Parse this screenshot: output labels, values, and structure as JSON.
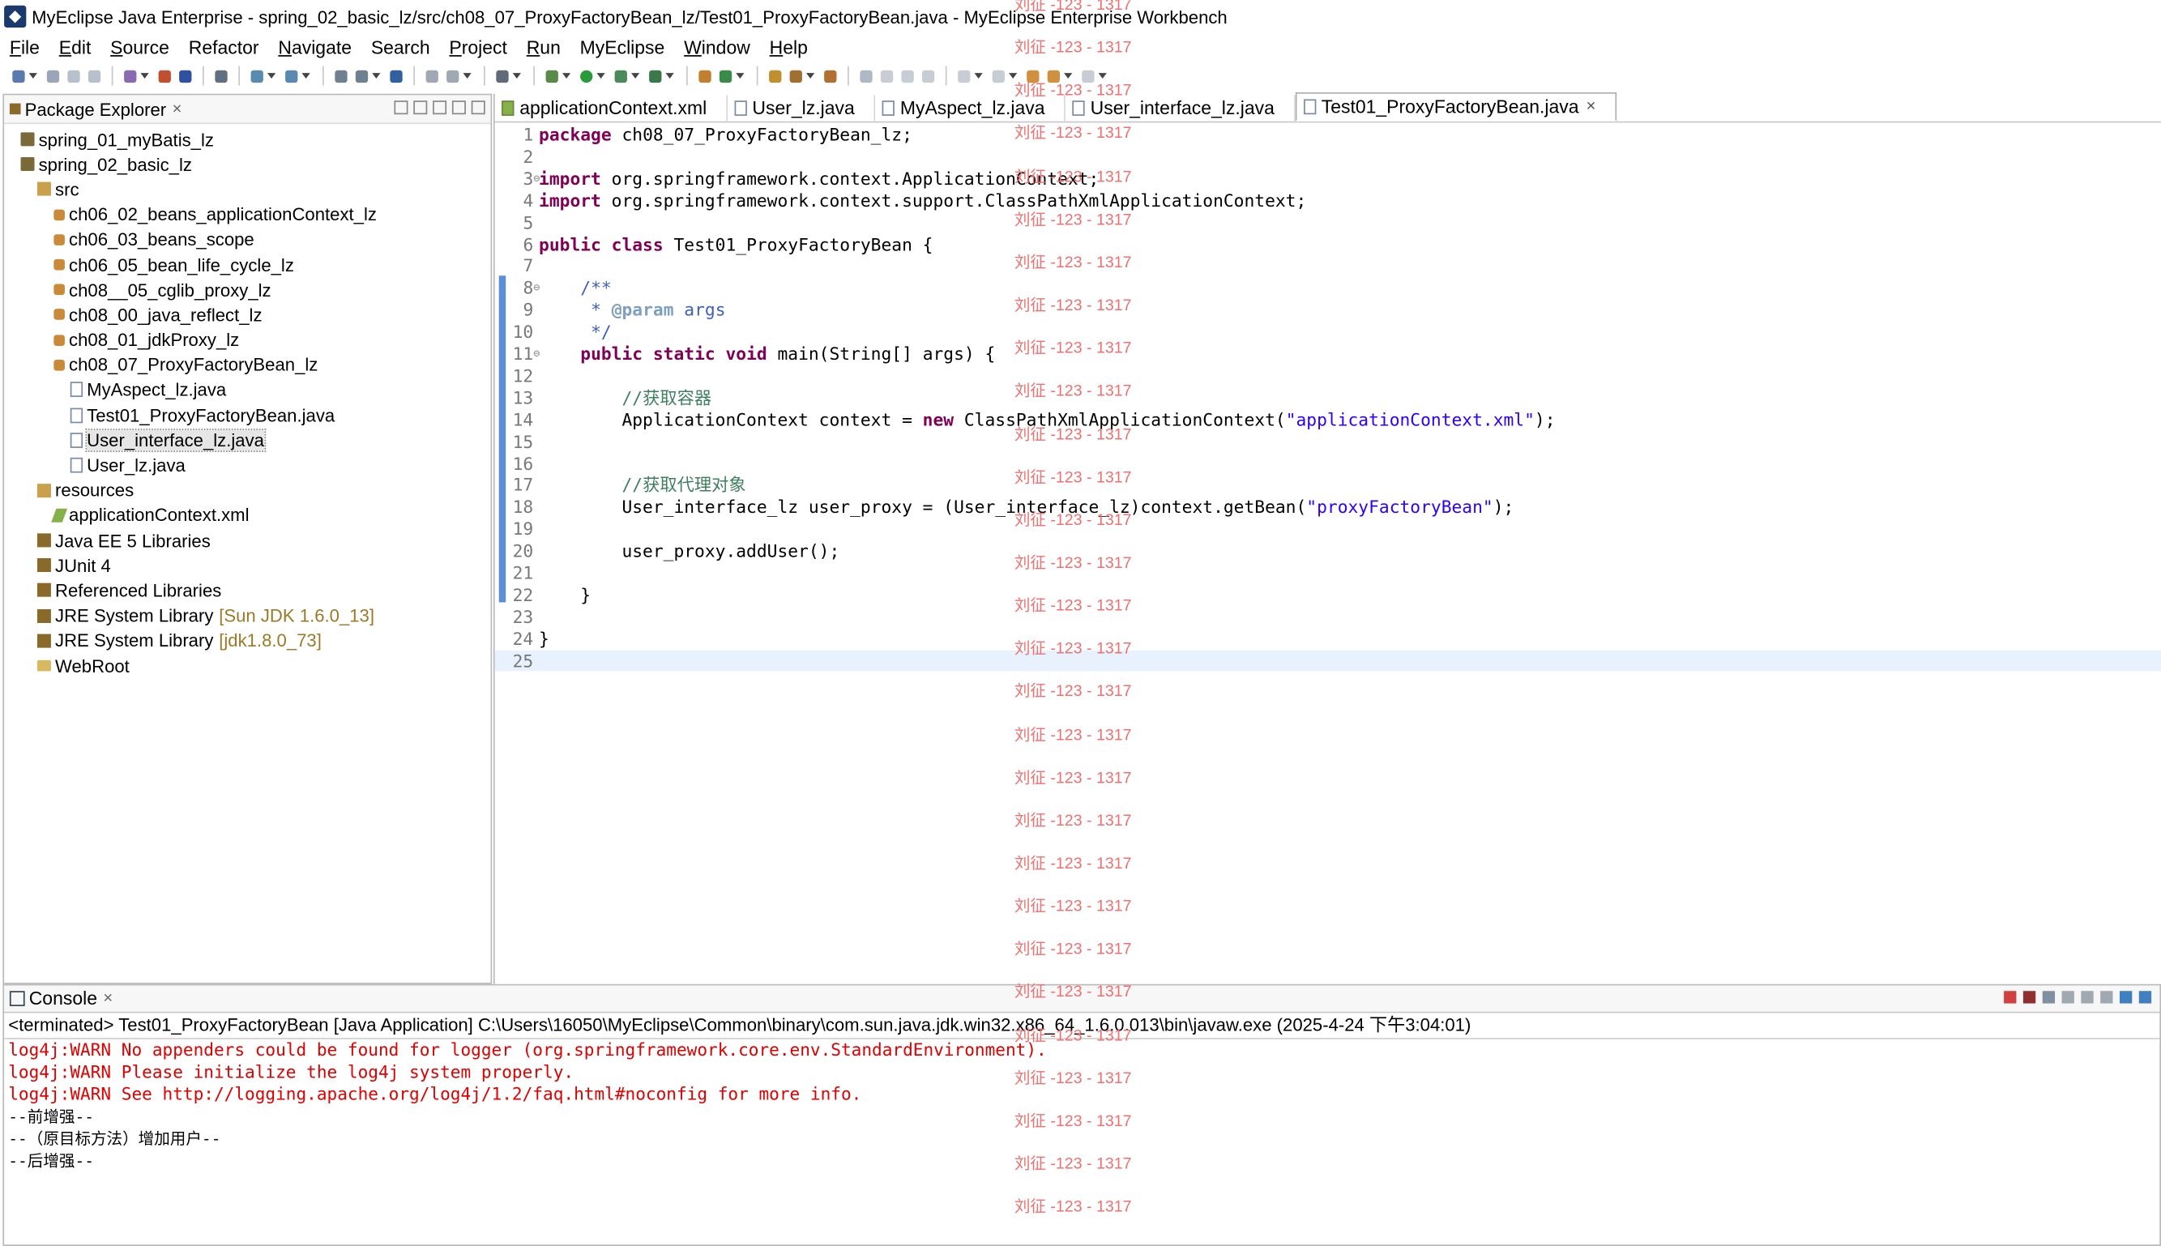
{
  "window": {
    "title": "MyEclipse Java Enterprise - spring_02_basic_lz/src/ch08_07_ProxyFactoryBean_lz/Test01_ProxyFactoryBean.java - MyEclipse Enterprise Workbench"
  },
  "menu": [
    {
      "label": "File",
      "mnemonic": "F",
      "rest": "ile"
    },
    {
      "label": "Edit",
      "mnemonic": "E",
      "rest": "dit"
    },
    {
      "label": "Source",
      "mnemonic": "S",
      "rest": "ource"
    },
    {
      "label": "Refactor",
      "mnemonic": "",
      "rest": "Refactor"
    },
    {
      "label": "Navigate",
      "mnemonic": "N",
      "rest": "avigate"
    },
    {
      "label": "Search",
      "mnemonic": "",
      "rest": "Search"
    },
    {
      "label": "Project",
      "mnemonic": "P",
      "rest": "roject"
    },
    {
      "label": "Run",
      "mnemonic": "R",
      "rest": "un"
    },
    {
      "label": "MyEclipse",
      "mnemonic": "",
      "rest": "MyEclipse"
    },
    {
      "label": "Window",
      "mnemonic": "W",
      "rest": "indow"
    },
    {
      "label": "Help",
      "mnemonic": "H",
      "rest": "elp"
    }
  ],
  "package_explorer": {
    "title": "Package Explorer",
    "tree": [
      {
        "label": "spring_01_myBatis_lz",
        "icon": "project-icon"
      },
      {
        "label": "spring_02_basic_lz",
        "icon": "project-icon"
      },
      {
        "label": "src",
        "icon": "source-folder-icon"
      },
      {
        "label": "ch06_02_beans_applicationContext_lz",
        "icon": "package-icon"
      },
      {
        "label": "ch06_03_beans_scope",
        "icon": "package-icon"
      },
      {
        "label": "ch06_05_bean_life_cycle_lz",
        "icon": "package-icon"
      },
      {
        "label": "ch08__05_cglib_proxy_lz",
        "icon": "package-icon"
      },
      {
        "label": "ch08_00_java_reflect_lz",
        "icon": "package-icon"
      },
      {
        "label": "ch08_01_jdkProxy_lz",
        "icon": "package-icon"
      },
      {
        "label": "ch08_07_ProxyFactoryBean_lz",
        "icon": "package-icon"
      },
      {
        "label": "MyAspect_lz.java",
        "icon": "java-file-icon"
      },
      {
        "label": "Test01_ProxyFactoryBean.java",
        "icon": "java-file-icon"
      },
      {
        "label": "User_interface_lz.java",
        "icon": "java-file-icon",
        "selected": true
      },
      {
        "label": "User_lz.java",
        "icon": "java-file-icon"
      },
      {
        "label": "resources",
        "icon": "source-folder-icon"
      },
      {
        "label": "applicationContext.xml",
        "icon": "xml-file-icon"
      },
      {
        "label": "Java EE 5 Libraries",
        "icon": "library-icon"
      },
      {
        "label": "JUnit 4",
        "icon": "library-icon"
      },
      {
        "label": "Referenced Libraries",
        "icon": "library-icon"
      },
      {
        "label": "JRE System Library",
        "icon": "library-icon",
        "decoration": "[Sun JDK 1.6.0_13]"
      },
      {
        "label": "JRE System Library",
        "icon": "library-icon",
        "decoration": "[jdk1.8.0_73]"
      },
      {
        "label": "WebRoot",
        "icon": "folder-icon"
      }
    ]
  },
  "editor": {
    "tabs": [
      {
        "label": "applicationContext.xml",
        "icon": "xml-file-icon",
        "active": false
      },
      {
        "label": "User_lz.java",
        "icon": "java-file-icon",
        "active": false
      },
      {
        "label": "MyAspect_lz.java",
        "icon": "java-file-icon",
        "active": false
      },
      {
        "label": "User_interface_lz.java",
        "icon": "java-file-icon",
        "active": false
      },
      {
        "label": "Test01_ProxyFactoryBean.java",
        "icon": "java-file-icon",
        "active": true
      }
    ],
    "lines": [
      {
        "n": "1",
        "tokens": [
          [
            "kw",
            "package"
          ],
          [
            "t",
            " ch08_07_ProxyFactoryBean_lz;"
          ]
        ]
      },
      {
        "n": "2",
        "tokens": []
      },
      {
        "n": "3",
        "fold": "⊖",
        "tokens": [
          [
            "kw",
            "import"
          ],
          [
            "t",
            " org.springframework.context.ApplicationContext;"
          ]
        ]
      },
      {
        "n": "4",
        "tokens": [
          [
            "kw",
            "import"
          ],
          [
            "t",
            " org.springframework.context.support.ClassPathXmlApplicationContext;"
          ]
        ]
      },
      {
        "n": "5",
        "tokens": []
      },
      {
        "n": "6",
        "tokens": [
          [
            "kw",
            "public class"
          ],
          [
            "t",
            " Test01_ProxyFactoryBean {"
          ]
        ]
      },
      {
        "n": "7",
        "tokens": []
      },
      {
        "n": "8",
        "fold": "⊖",
        "tokens": [
          [
            "t",
            "    "
          ],
          [
            "jd",
            "/**"
          ]
        ]
      },
      {
        "n": "9",
        "tokens": [
          [
            "t",
            "     "
          ],
          [
            "jd",
            "* "
          ],
          [
            "jdt",
            "@param"
          ],
          [
            "jd",
            " args"
          ]
        ]
      },
      {
        "n": "10",
        "tokens": [
          [
            "t",
            "     "
          ],
          [
            "jd",
            "*/"
          ]
        ]
      },
      {
        "n": "11",
        "fold": "⊖",
        "tokens": [
          [
            "t",
            "    "
          ],
          [
            "kw",
            "public static void"
          ],
          [
            "t",
            " main(String[] args) {"
          ]
        ]
      },
      {
        "n": "12",
        "tokens": []
      },
      {
        "n": "13",
        "tokens": [
          [
            "t",
            "        "
          ],
          [
            "cm",
            "//获取容器"
          ]
        ]
      },
      {
        "n": "14",
        "tokens": [
          [
            "t",
            "        ApplicationContext context = "
          ],
          [
            "kw",
            "new"
          ],
          [
            "t",
            " ClassPathXmlApplicationContext("
          ],
          [
            "str",
            "\"applicationContext.xml\""
          ],
          [
            "t",
            ");"
          ]
        ]
      },
      {
        "n": "15",
        "tokens": []
      },
      {
        "n": "16",
        "tokens": []
      },
      {
        "n": "17",
        "tokens": [
          [
            "t",
            "        "
          ],
          [
            "cm",
            "//获取代理对象"
          ]
        ]
      },
      {
        "n": "18",
        "tokens": [
          [
            "t",
            "        User_interface_lz user_proxy = (User_interface_lz)context.getBean("
          ],
          [
            "str",
            "\"proxyFactoryBean\""
          ],
          [
            "t",
            ");"
          ]
        ]
      },
      {
        "n": "19",
        "tokens": []
      },
      {
        "n": "20",
        "tokens": [
          [
            "t",
            "        user_proxy.addUser();"
          ]
        ]
      },
      {
        "n": "21",
        "tokens": []
      },
      {
        "n": "22",
        "tokens": [
          [
            "t",
            "    }"
          ]
        ]
      },
      {
        "n": "23",
        "tokens": []
      },
      {
        "n": "24",
        "tokens": [
          [
            "t",
            "}"
          ]
        ]
      },
      {
        "n": "25",
        "tokens": [],
        "current": true
      }
    ]
  },
  "console": {
    "title": "Console",
    "status": "<terminated> Test01_ProxyFactoryBean [Java Application] C:\\Users\\16050\\MyEclipse\\Common\\binary\\com.sun.java.jdk.win32.x86_64_1.6.0.013\\bin\\javaw.exe (2025-4-24 下午3:04:01)",
    "lines": [
      {
        "text": "log4j:WARN No appenders could be found for logger (org.springframework.core.env.StandardEnvironment).",
        "kind": "warn"
      },
      {
        "text": "log4j:WARN Please initialize the log4j system properly.",
        "kind": "warn"
      },
      {
        "text": "log4j:WARN See http://logging.apache.org/log4j/1.2/faq.html#noconfig for more info.",
        "kind": "warn"
      },
      {
        "text": "--前增强--",
        "kind": "out"
      },
      {
        "text": "--（原目标方法）增加用户--",
        "kind": "out"
      },
      {
        "text": "--后增强--",
        "kind": "out"
      }
    ]
  },
  "watermark": {
    "text": "刘征 -123 - 1317",
    "color": "#f07070"
  },
  "colors": {
    "keyword": "#7f0055",
    "string": "#2a00ff",
    "comment": "#3f7f5f",
    "javadoc": "#3f5fbf",
    "warn": "#e00000",
    "current_line": "#e8f2fe"
  }
}
